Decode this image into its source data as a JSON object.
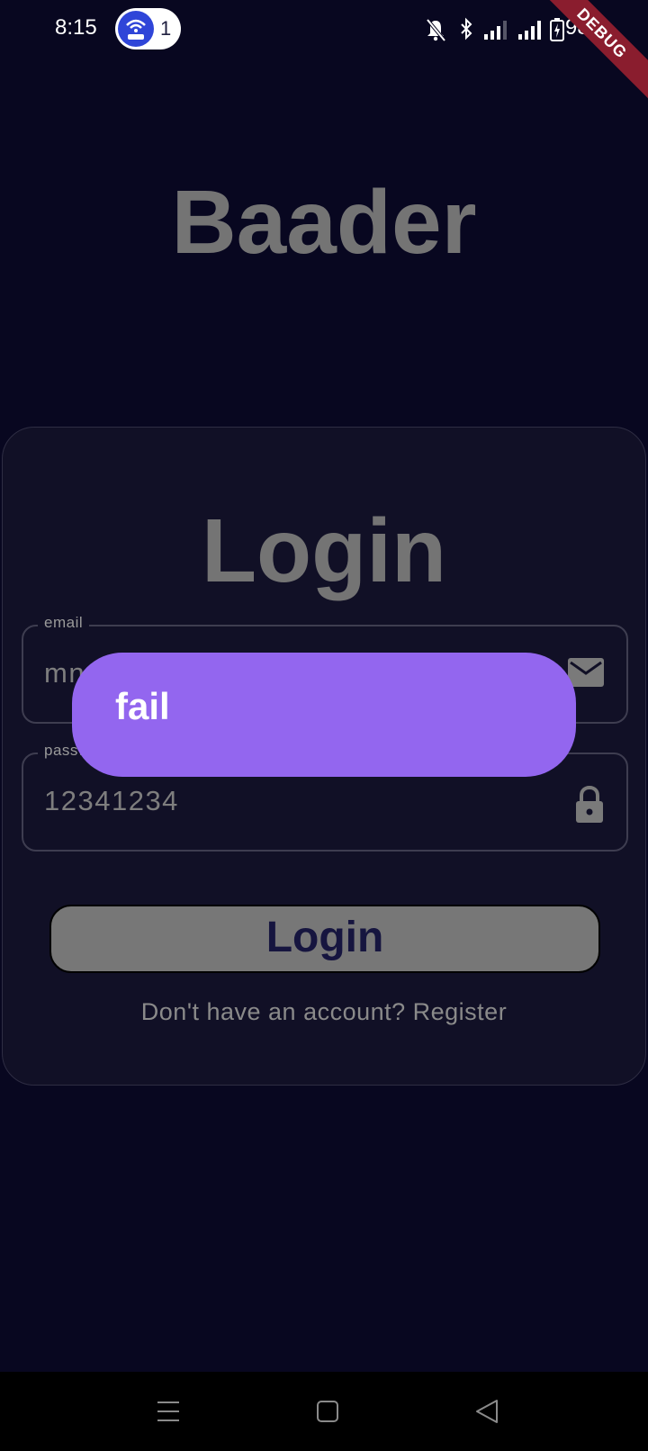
{
  "status_bar": {
    "time": "8:15",
    "hotspot_count": "1",
    "battery_percent": "98%",
    "icons": [
      "hotspot-icon",
      "mute-icon",
      "bluetooth-icon",
      "signal-icon",
      "signal-icon",
      "battery-charging-icon"
    ]
  },
  "debug_banner": "DEBUG",
  "app_title": "Baader",
  "login": {
    "heading": "Login",
    "email": {
      "label": "email",
      "value": "mn",
      "icon": "mail-icon"
    },
    "password": {
      "label": "passw",
      "value": "12341234",
      "icon": "lock-icon"
    },
    "button_label": "Login",
    "register_prompt": "Don't have an account? Register"
  },
  "toast": {
    "message": "fail"
  },
  "nav_bar": {
    "icons": [
      "menu-icon",
      "home-icon",
      "back-icon"
    ]
  },
  "colors": {
    "background": "#080720",
    "card": "#111026",
    "toast": "#9366ef",
    "button": "#777777",
    "debug_banner": "#8a1d2e"
  }
}
